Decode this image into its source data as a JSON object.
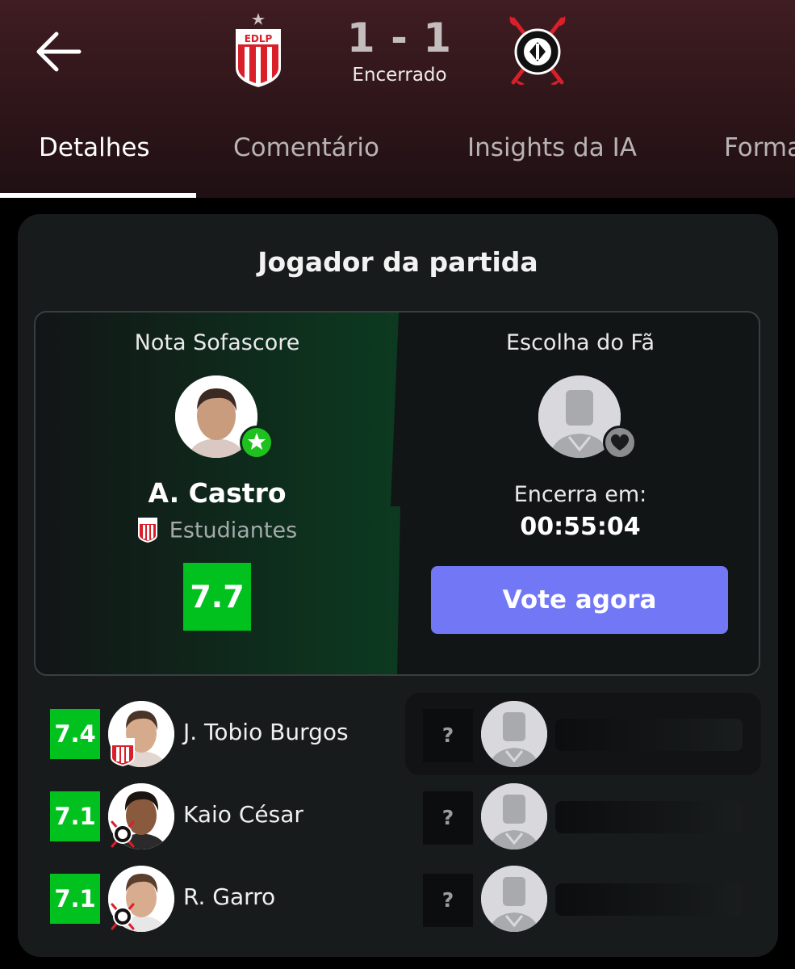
{
  "header": {
    "back_icon": "arrow-left-icon",
    "home_crest_text": "EDLP",
    "score": "1 - 1",
    "status": "Encerrado",
    "colors": {
      "background": "#2e1519",
      "home_red": "#d81f2a",
      "away_black": "#000000"
    }
  },
  "tabs": [
    {
      "label": "Detalhes",
      "active": true
    },
    {
      "label": "Comentário",
      "active": false
    },
    {
      "label": "Insights da IA",
      "active": false
    },
    {
      "label": "Forma",
      "active": false
    }
  ],
  "card": {
    "title": "Jogador da partida",
    "sofascore": {
      "heading": "Nota Sofascore",
      "player": "A. Castro",
      "team": "Estudiantes",
      "rating": "7.7",
      "badge_icon": "star-icon"
    },
    "fan": {
      "heading": "Escolha do Fã",
      "ends_label": "Encerra em:",
      "countdown": "00:55:04",
      "vote_label": "Vote agora",
      "badge_icon": "heart-icon"
    },
    "players": [
      {
        "rating": "7.4",
        "name": "J. Tobio Burgos",
        "team_crest": "estudiantes"
      },
      {
        "rating": "7.1",
        "name": "Kaio César",
        "team_crest": "corinthians"
      },
      {
        "rating": "7.1",
        "name": "R. Garro",
        "team_crest": "corinthians"
      }
    ],
    "fan_placeholders": [
      "?",
      "?",
      "?"
    ],
    "colors": {
      "rating_green": "#00c11e",
      "vote_button": "#7277f5",
      "card_bg": "#181b1c"
    }
  }
}
